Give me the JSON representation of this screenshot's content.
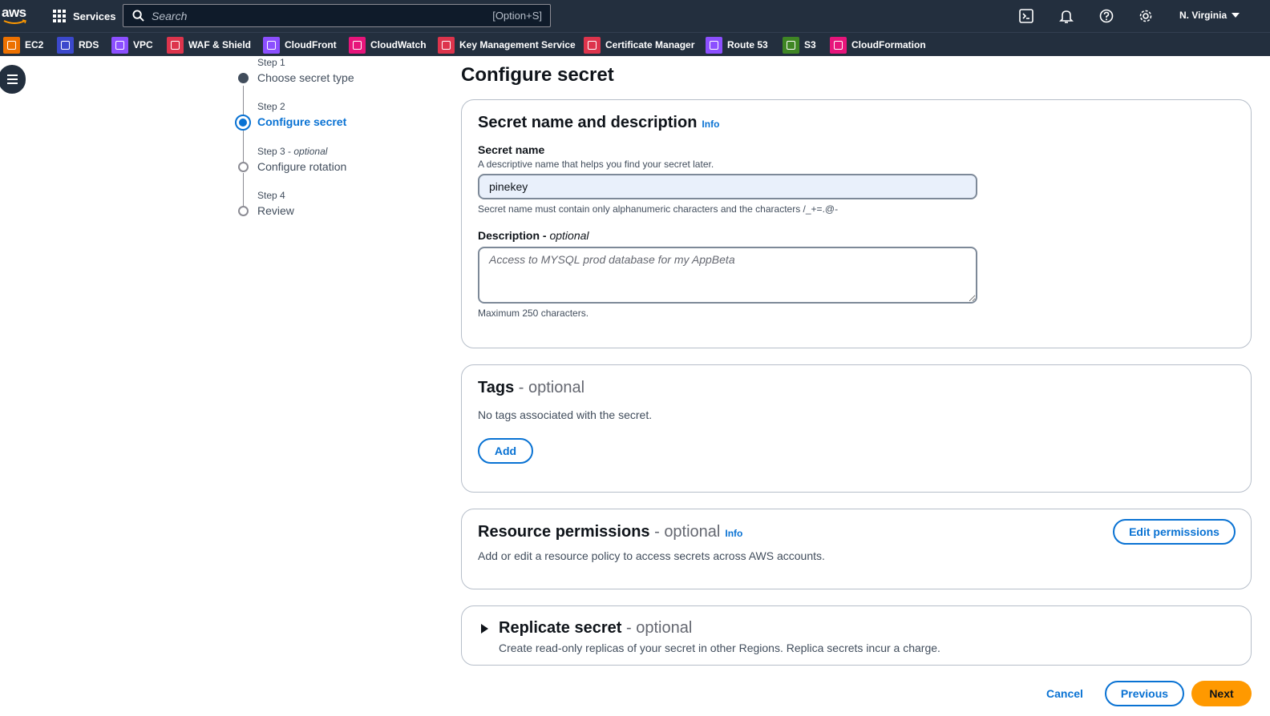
{
  "topnav": {
    "logo": "aws",
    "services_label": "Services",
    "search_placeholder": "Search",
    "search_shortcut": "[Option+S]",
    "region": "N. Virginia",
    "icons": [
      "cloudshell-icon",
      "bell-icon",
      "help-icon",
      "gear-icon"
    ]
  },
  "favorites": [
    {
      "label": "EC2",
      "color": "#ed7100"
    },
    {
      "label": "RDS",
      "color": "#3b48cc"
    },
    {
      "label": "VPC",
      "color": "#8c4fff"
    },
    {
      "label": "WAF & Shield",
      "color": "#dd344c"
    },
    {
      "label": "CloudFront",
      "color": "#8c4fff"
    },
    {
      "label": "CloudWatch",
      "color": "#e7157b"
    },
    {
      "label": "Key Management Service",
      "color": "#dd344c"
    },
    {
      "label": "Certificate Manager",
      "color": "#dd344c"
    },
    {
      "label": "Route 53",
      "color": "#8c4fff"
    },
    {
      "label": "S3",
      "color": "#3f8624"
    },
    {
      "label": "CloudFormation",
      "color": "#e7157b"
    }
  ],
  "steps": [
    {
      "label": "Step 1",
      "optional": "",
      "title": "Choose secret type"
    },
    {
      "label": "Step 2",
      "optional": "",
      "title": "Configure secret"
    },
    {
      "label": "Step 3",
      "optional": "optional",
      "title": "Configure rotation"
    },
    {
      "label": "Step 4",
      "optional": "",
      "title": "Review"
    }
  ],
  "page_title": "Configure secret",
  "name_panel": {
    "header": "Secret name and description",
    "info": "Info",
    "name_label": "Secret name",
    "name_desc": "A descriptive name that helps you find your secret later.",
    "name_value": "pinekey",
    "name_constraint": "Secret name must contain only alphanumeric characters and the characters /_+=.@-",
    "desc_label": "Description",
    "desc_optional": "optional",
    "desc_placeholder": "Access to MYSQL prod database for my AppBeta",
    "desc_constraint": "Maximum 250 characters."
  },
  "tags_panel": {
    "header": "Tags",
    "optional": "optional",
    "empty_text": "No tags associated with the secret.",
    "add_label": "Add"
  },
  "permissions_panel": {
    "header": "Resource permissions",
    "optional": "optional",
    "info": "Info",
    "text": "Add or edit a resource policy to access secrets across AWS accounts.",
    "edit_label": "Edit permissions"
  },
  "replicate_panel": {
    "header": "Replicate secret",
    "optional": "optional",
    "text": "Create read-only replicas of your secret in other Regions. Replica secrets incur a charge."
  },
  "footer": {
    "cancel": "Cancel",
    "previous": "Previous",
    "next": "Next"
  }
}
